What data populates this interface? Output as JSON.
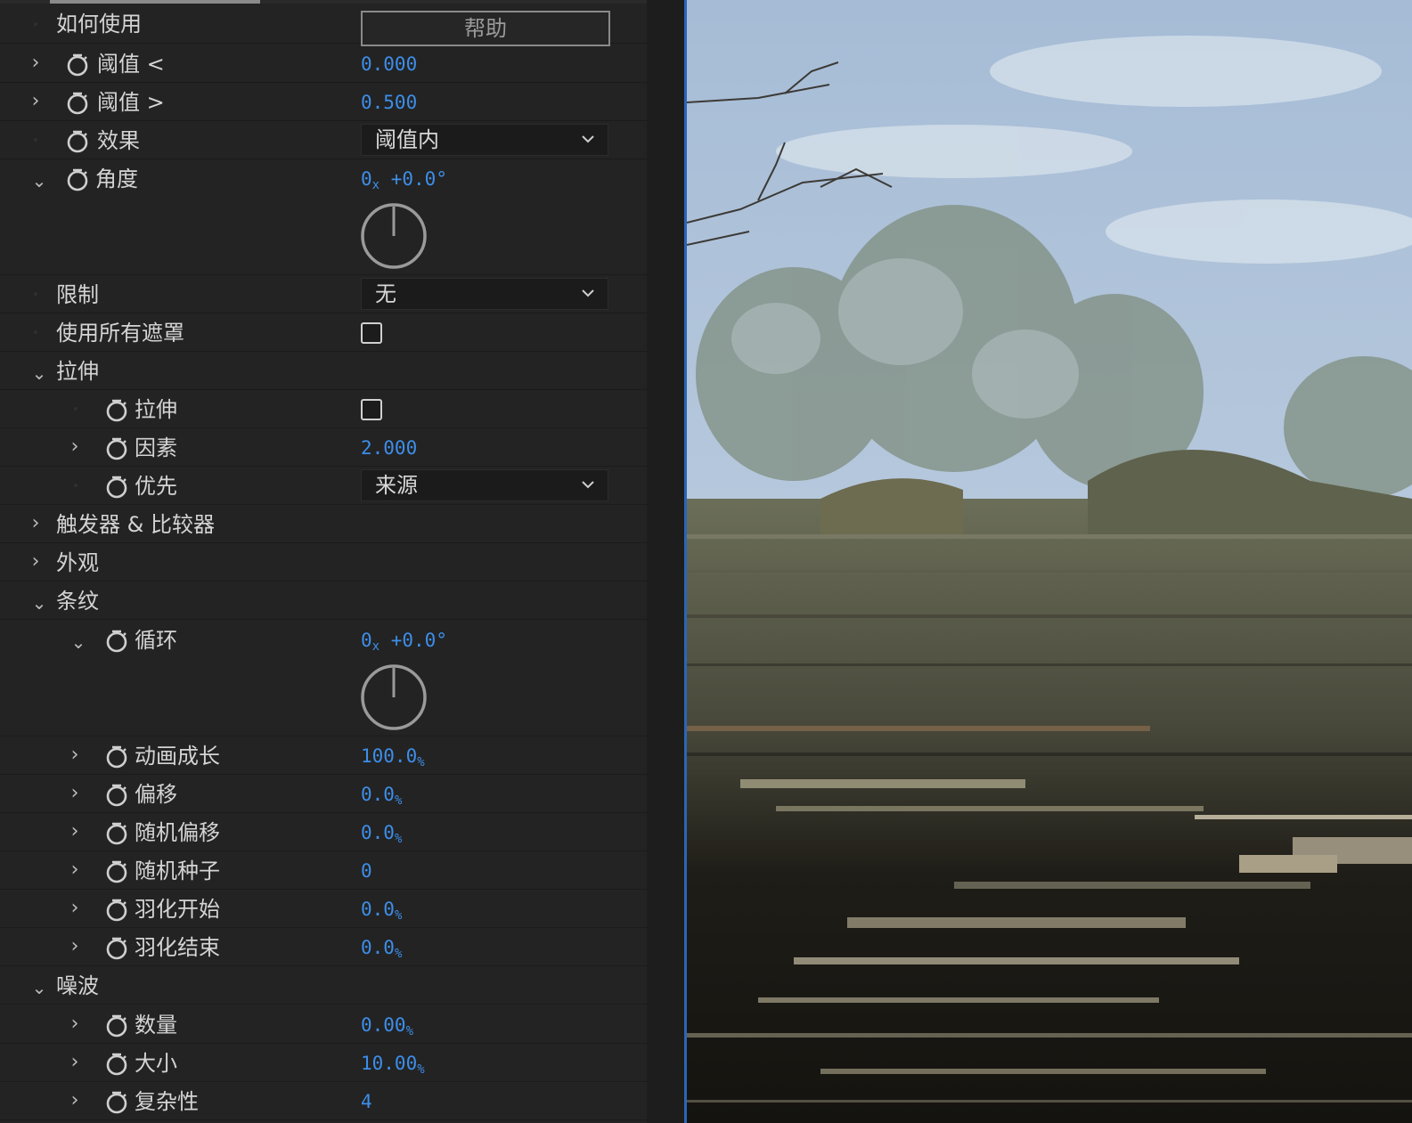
{
  "panel": {
    "help": {
      "label": "如何使用",
      "button": "帮助"
    },
    "rows": {
      "threshold_lt": {
        "label": "阈值 <",
        "value": "0.000"
      },
      "threshold_gt": {
        "label": "阈值 >",
        "value": "0.500"
      },
      "effect": {
        "label": "效果",
        "value": "阈值内"
      },
      "angle": {
        "label": "角度",
        "value_rev": "0",
        "value_x": "x",
        "value_deg": "+0.0°"
      },
      "limit": {
        "label": "限制",
        "value": "无"
      },
      "use_all_masks": {
        "label": "使用所有遮罩",
        "checked": false
      },
      "stretch_group": {
        "label": "拉伸"
      },
      "stretch": {
        "label": "拉伸",
        "checked": false
      },
      "factor": {
        "label": "因素",
        "value": "2.000"
      },
      "priority": {
        "label": "优先",
        "value": "来源"
      },
      "trigger_group": {
        "label": "触发器 & 比较器"
      },
      "appearance_group": {
        "label": "外观"
      },
      "stripes_group": {
        "label": "条纹"
      },
      "cycle": {
        "label": "循环",
        "value_rev": "0",
        "value_x": "x",
        "value_deg": "+0.0°"
      },
      "anim_growth": {
        "label": "动画成长",
        "value": "100.0",
        "unit": "%"
      },
      "offset": {
        "label": "偏移",
        "value": "0.0",
        "unit": "%"
      },
      "random_offset": {
        "label": "随机偏移",
        "value": "0.0",
        "unit": "%"
      },
      "random_seed": {
        "label": "随机种子",
        "value": "0"
      },
      "feather_start": {
        "label": "羽化开始",
        "value": "0.0",
        "unit": "%"
      },
      "feather_end": {
        "label": "羽化结束",
        "value": "0.0",
        "unit": "%"
      },
      "noise_group": {
        "label": "噪波"
      },
      "amount": {
        "label": "数量",
        "value": "0.00",
        "unit": "%"
      },
      "size": {
        "label": "大小",
        "value": "10.00",
        "unit": "%"
      },
      "complexity": {
        "label": "复杂性",
        "value": "4"
      }
    }
  },
  "colors": {
    "value_blue": "#3d8ee9",
    "panel_bg": "#232323",
    "accent_divider": "#2a65b8"
  }
}
